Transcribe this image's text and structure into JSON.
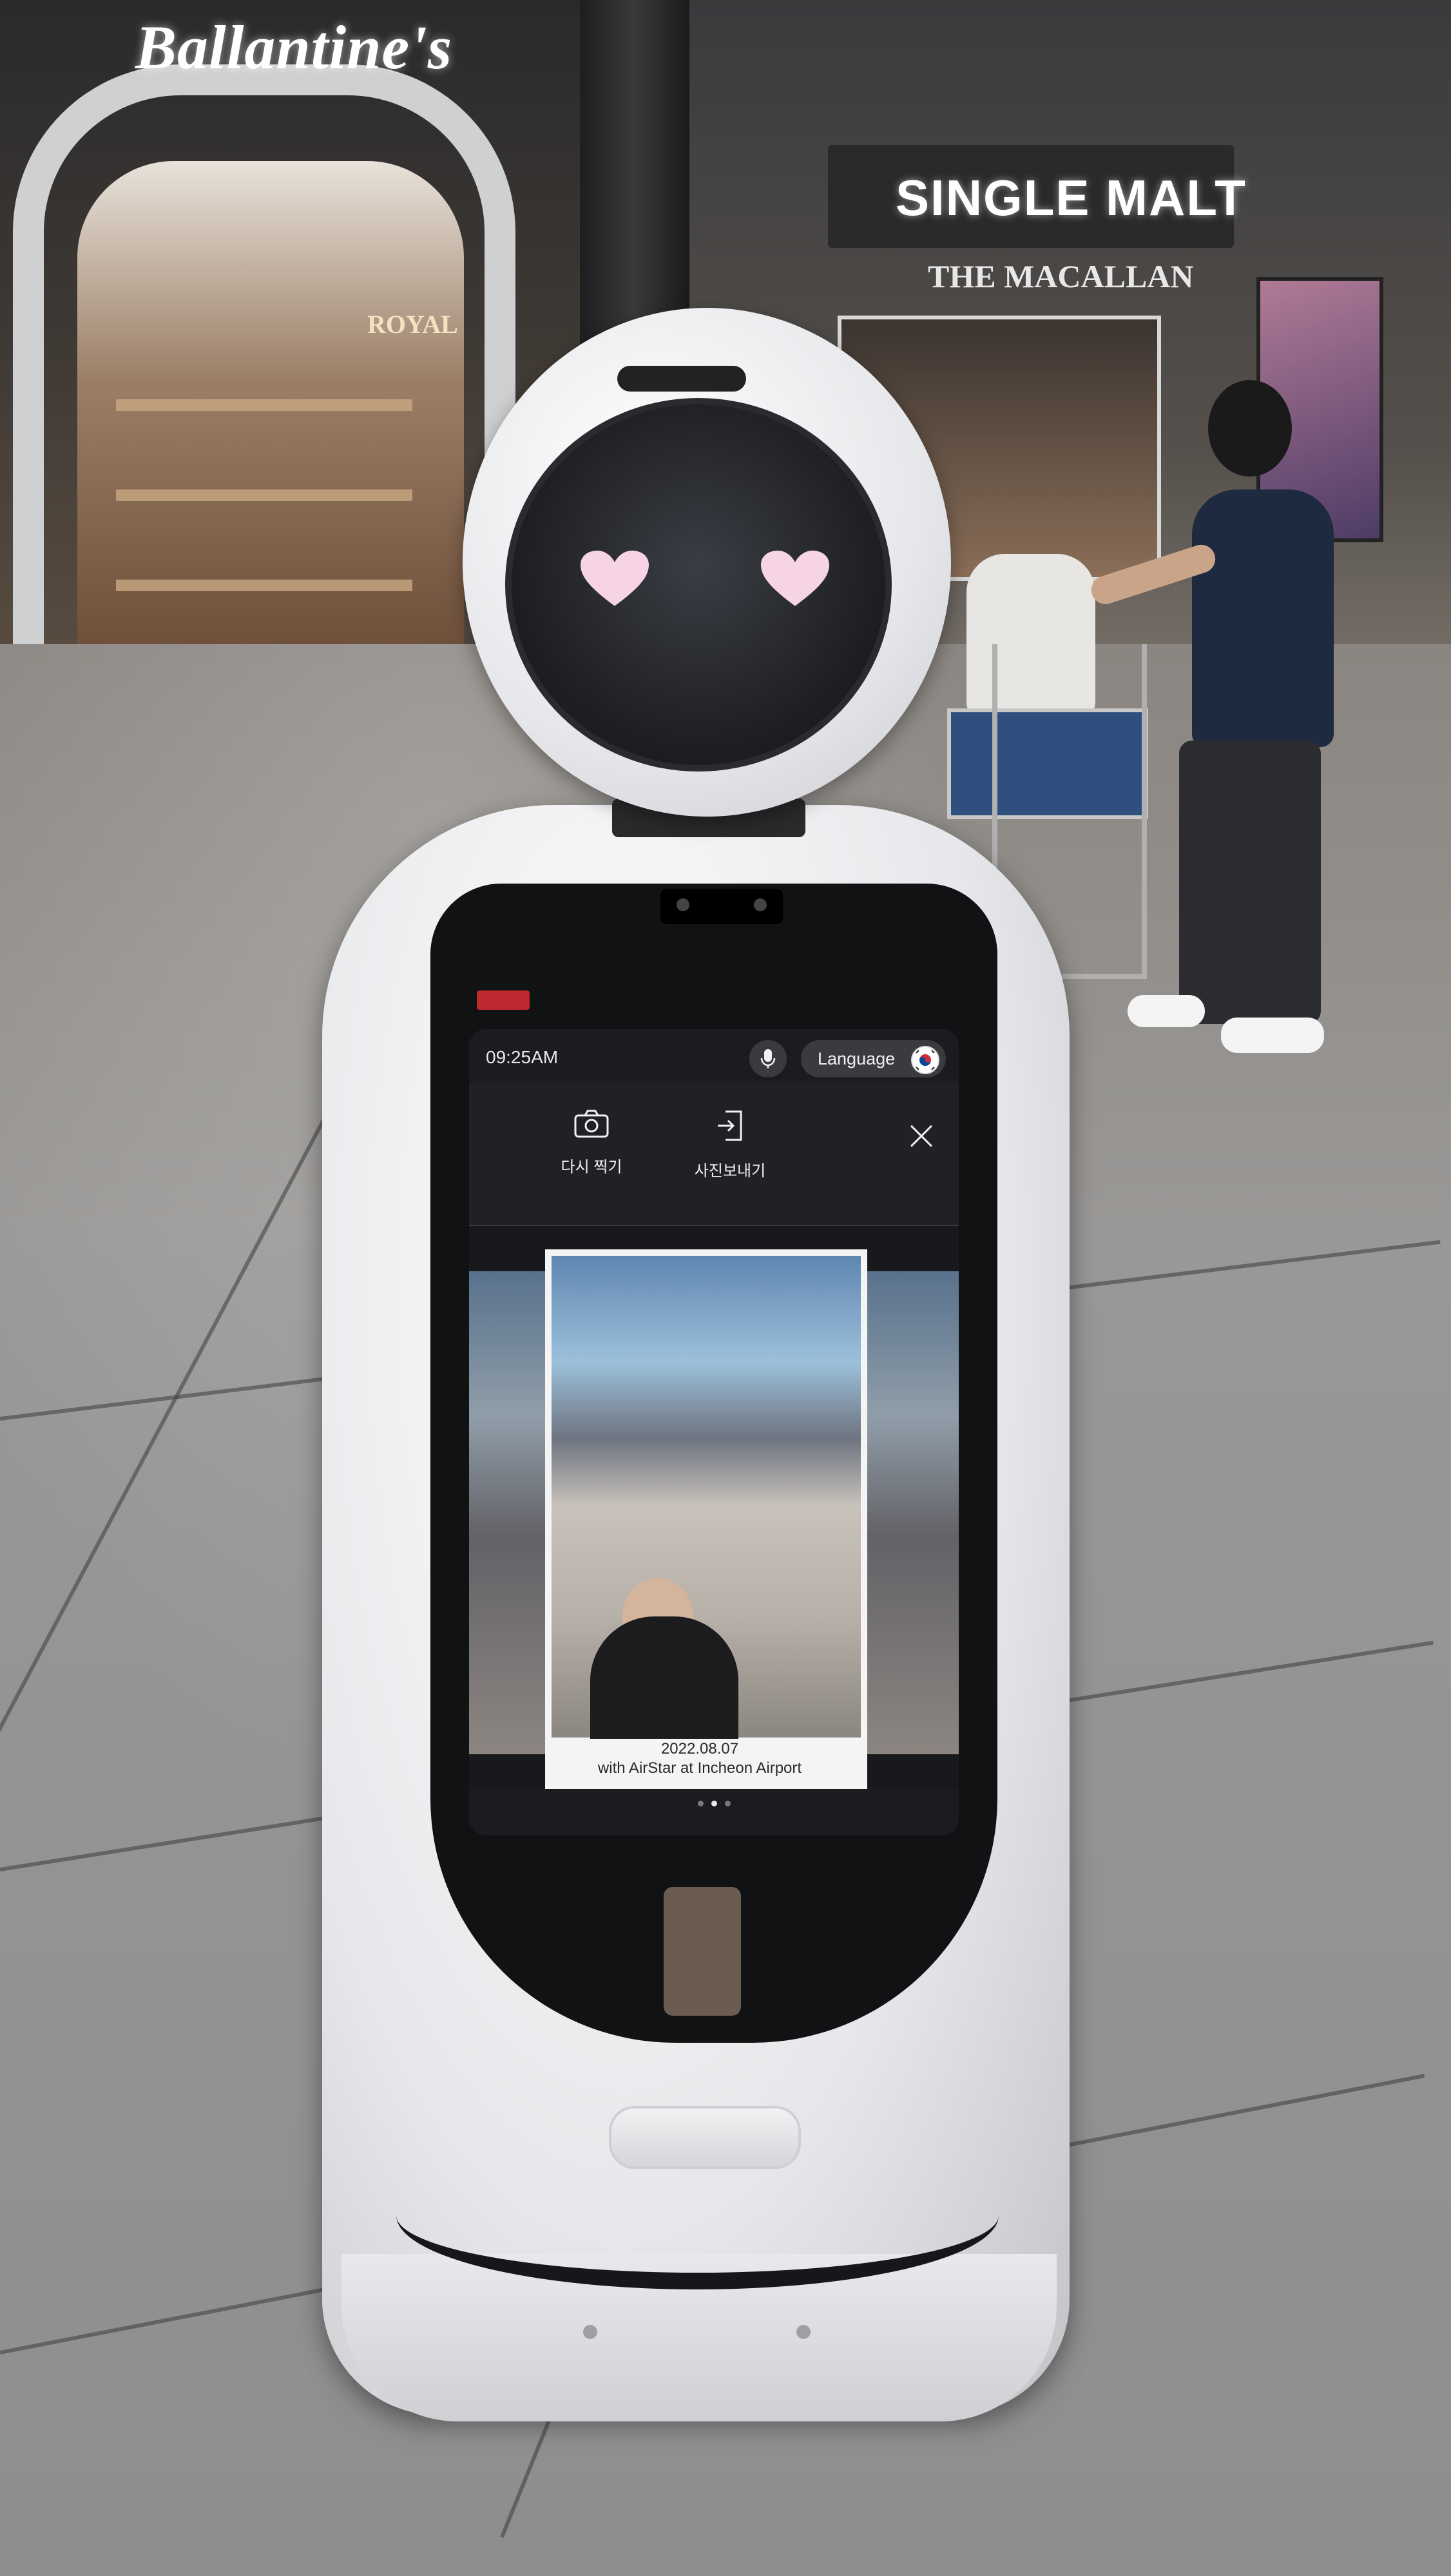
{
  "scene": {
    "sign_left": "Ballantine's",
    "sign_left_small": "ROYAL",
    "sign_right": "SINGLE MALT",
    "sign_right_sub": "THE MACALLAN"
  },
  "screen": {
    "clock": "09:25AM",
    "language_label": "Language",
    "actions": [
      {
        "label": "다시 찍기",
        "icon": "camera-icon"
      },
      {
        "label": "사진보내기",
        "icon": "send-icon"
      }
    ],
    "close_icon": "close-icon",
    "photo": {
      "date": "2022.08.07",
      "caption": "with AirStar at Incheon Airport"
    },
    "pager": {
      "count": 3,
      "active": 1
    }
  },
  "colors": {
    "screen_bg": "#1b1c1f",
    "button_bg": "#3a3b3f",
    "robot_white": "#e6e7ea",
    "badge_red": "#c0282f"
  }
}
